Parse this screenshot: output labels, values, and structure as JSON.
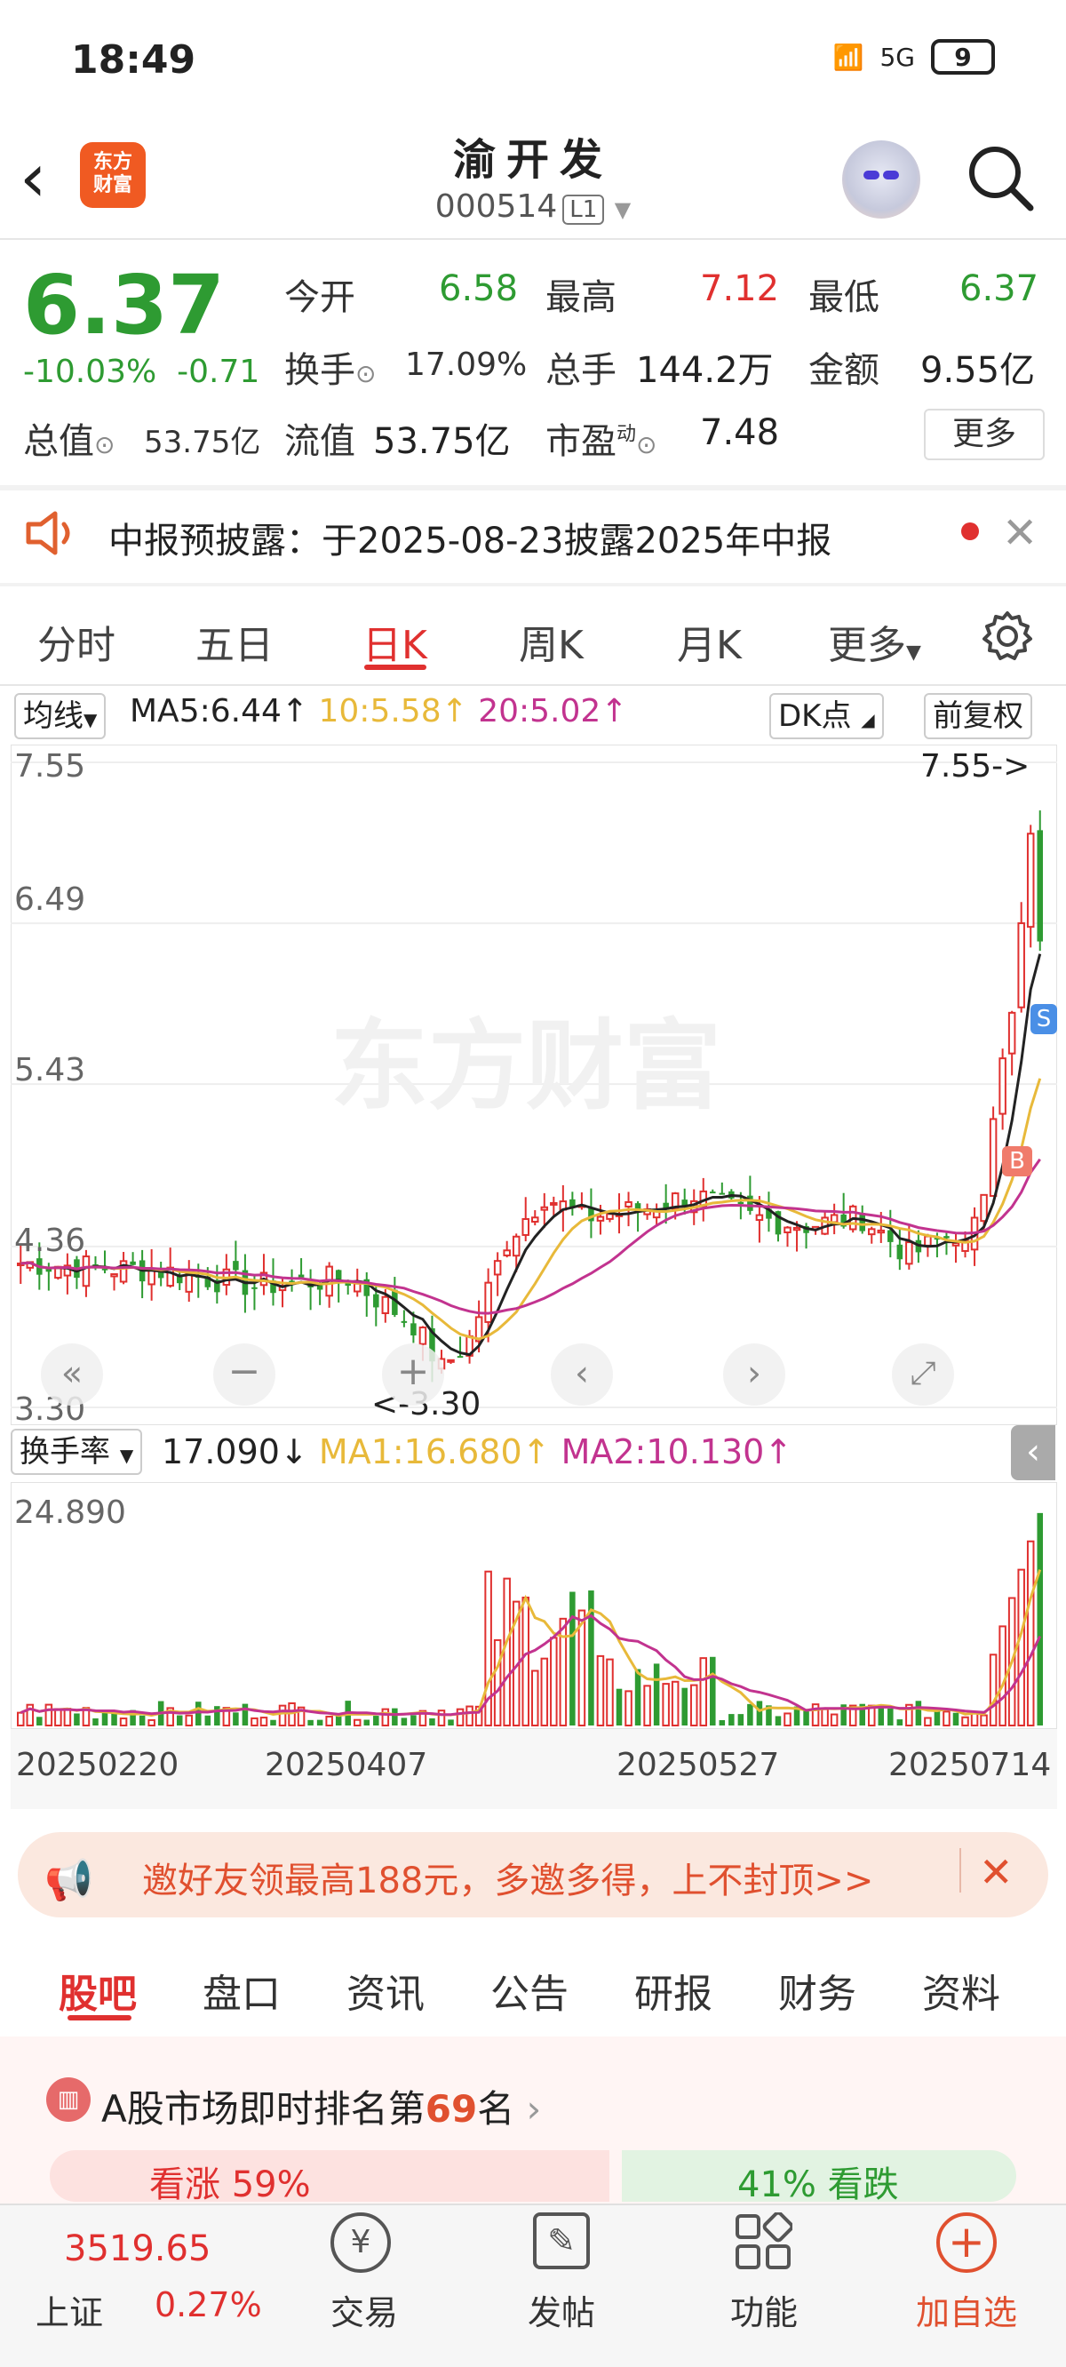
{
  "status_bar": {
    "time": "18:49",
    "network": "5G",
    "battery": "9"
  },
  "header": {
    "logo_text": "东方财富",
    "name": "渝开发",
    "code": "000514",
    "level": "L1"
  },
  "quote": {
    "price": "6.37",
    "change_pct": "-10.03%",
    "change_abs": "-0.71",
    "open_label": "今开",
    "open": "6.58",
    "high_label": "最高",
    "high": "7.12",
    "low_label": "最低",
    "low": "6.37",
    "turnover_label": "换手",
    "turnover": "17.09%",
    "volume_label": "总手",
    "volume": "144.2万",
    "amount_label": "金额",
    "amount": "9.55亿",
    "mktcap_label": "总值",
    "mktcap": "53.75亿",
    "float_label": "流值",
    "float_cap": "53.75亿",
    "pe_label": "市盈",
    "pe_sup": "动",
    "pe": "7.48",
    "more_label": "更多"
  },
  "notice": {
    "text": "中报预披露：于2025-08-23披露2025年中报"
  },
  "period_tabs": [
    "分时",
    "五日",
    "日K",
    "周K",
    "月K",
    "更多"
  ],
  "chart_header": {
    "indicator": "均线",
    "ma5": "MA5:6.44↑",
    "ma10": "10:5.58↑",
    "ma20": "20:5.02↑",
    "dk": "DK点",
    "adjust": "前复权"
  },
  "chart_axis": {
    "y_ticks": [
      "7.55",
      "6.49",
      "5.43",
      "4.36",
      "3.30"
    ],
    "high_marker": "7.55->",
    "low_marker": "<-3.30",
    "watermark": "东方财富"
  },
  "volume_header": {
    "indicator": "换手率",
    "value": "17.090↓",
    "ma1": "MA1:16.680↑",
    "ma2": "MA2:10.130↑",
    "max": "24.890"
  },
  "x_dates": [
    "20250220",
    "20250407",
    "20250527",
    "20250714"
  ],
  "colors": {
    "up": "#e0302f",
    "down": "#2e9b32",
    "ma5": "#222222",
    "ma10": "#e8b93a",
    "ma20": "#c2338f"
  },
  "chart_data": {
    "type": "candlestick",
    "title": "",
    "y_range": [
      3.3,
      7.55
    ],
    "recent_closes": [
      4.4,
      4.55,
      4.7,
      5.2,
      5.6,
      5.9,
      6.49,
      7.08,
      6.37
    ],
    "ma_lines": {
      "MA5": 6.44,
      "MA10": 5.58,
      "MA20": 5.02
    },
    "volume_y_max": 24.89,
    "turnover_ma": {
      "MA1": 16.68,
      "MA2": 10.13
    }
  },
  "invite": {
    "text": "邀好友领最高188元，多邀多得，上不封顶>>"
  },
  "sub_tabs": [
    "股吧",
    "盘口",
    "资讯",
    "公告",
    "研报",
    "财务",
    "资料"
  ],
  "rank": {
    "prefix": "A股市场即时排名第",
    "num": "69",
    "suffix": "名",
    "rise": "看涨 59%",
    "fall": "41% 看跌"
  },
  "bottom_nav": {
    "index_value": "3519.65",
    "index_name": "上证",
    "index_change": "0.27%",
    "trade": "交易",
    "post": "发帖",
    "func": "功能",
    "add": "加自选"
  }
}
